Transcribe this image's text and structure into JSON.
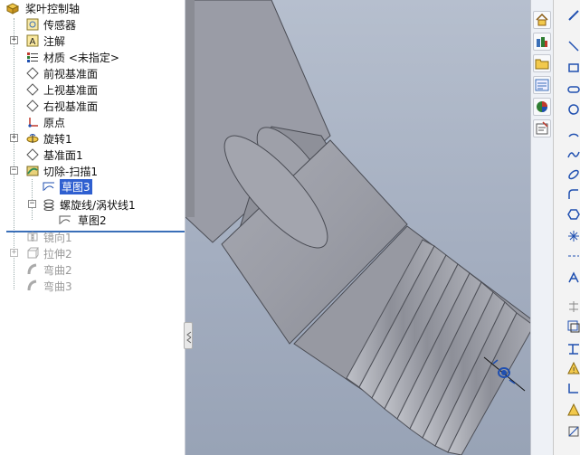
{
  "tree": {
    "root": "桨叶控制轴",
    "items": [
      {
        "label": "传感器",
        "icon": "sensor-icon",
        "state": "normal"
      },
      {
        "label": "注解",
        "icon": "annotation-icon",
        "state": "normal"
      },
      {
        "label": "材质 <未指定>",
        "icon": "material-icon",
        "state": "normal"
      },
      {
        "label": "前视基准面",
        "icon": "plane-icon",
        "state": "normal"
      },
      {
        "label": "上视基准面",
        "icon": "plane-icon",
        "state": "normal"
      },
      {
        "label": "右视基准面",
        "icon": "plane-icon",
        "state": "normal"
      },
      {
        "label": "原点",
        "icon": "origin-icon",
        "state": "normal"
      },
      {
        "label": "旋转1",
        "icon": "revolve-icon",
        "state": "normal"
      },
      {
        "label": "基准面1",
        "icon": "plane-icon",
        "state": "normal"
      },
      {
        "label": "切除-扫描1",
        "icon": "cut-sweep-icon",
        "state": "normal"
      },
      {
        "label": "草图3",
        "icon": "sketch-icon",
        "state": "selected"
      },
      {
        "label": "螺旋线/涡状线1",
        "icon": "helix-icon",
        "state": "normal"
      },
      {
        "label": "草图2",
        "icon": "sketch-icon",
        "state": "normal"
      },
      {
        "label": "镜向1",
        "icon": "mirror-icon",
        "state": "suppressed"
      },
      {
        "label": "拉伸2",
        "icon": "extrude-icon",
        "state": "suppressed"
      },
      {
        "label": "弯曲2",
        "icon": "flex-icon",
        "state": "suppressed"
      },
      {
        "label": "弯曲3",
        "icon": "flex-icon",
        "state": "suppressed"
      }
    ]
  },
  "colors": {
    "selection": "#2f5fd0",
    "rollback_bar": "#3a6fb8",
    "suppressed_text": "#9a9a9a",
    "viewport_bg": "#a8b2c4",
    "part_gray": "#9a9ca6"
  },
  "taskpane_icons": [
    "home-icon",
    "resources-icon",
    "folder-icon",
    "view-palette-icon",
    "appearance-icon",
    "custom-properties-icon"
  ],
  "sketch_tools": [
    "smart-dimension-icon",
    "line-icon",
    "rectangle-icon",
    "slot-icon",
    "circle-icon",
    "arc-icon",
    "spline-icon",
    "ellipse-icon",
    "sketch-fillet-icon",
    "polygon-icon",
    "point-icon",
    "centerline-icon",
    "text-icon",
    "trim-icon",
    "offset-icon",
    "mirror-entities-icon",
    "linear-pattern-icon",
    "display-relations-icon",
    "repair-sketch-icon",
    "quick-snaps-icon"
  ]
}
